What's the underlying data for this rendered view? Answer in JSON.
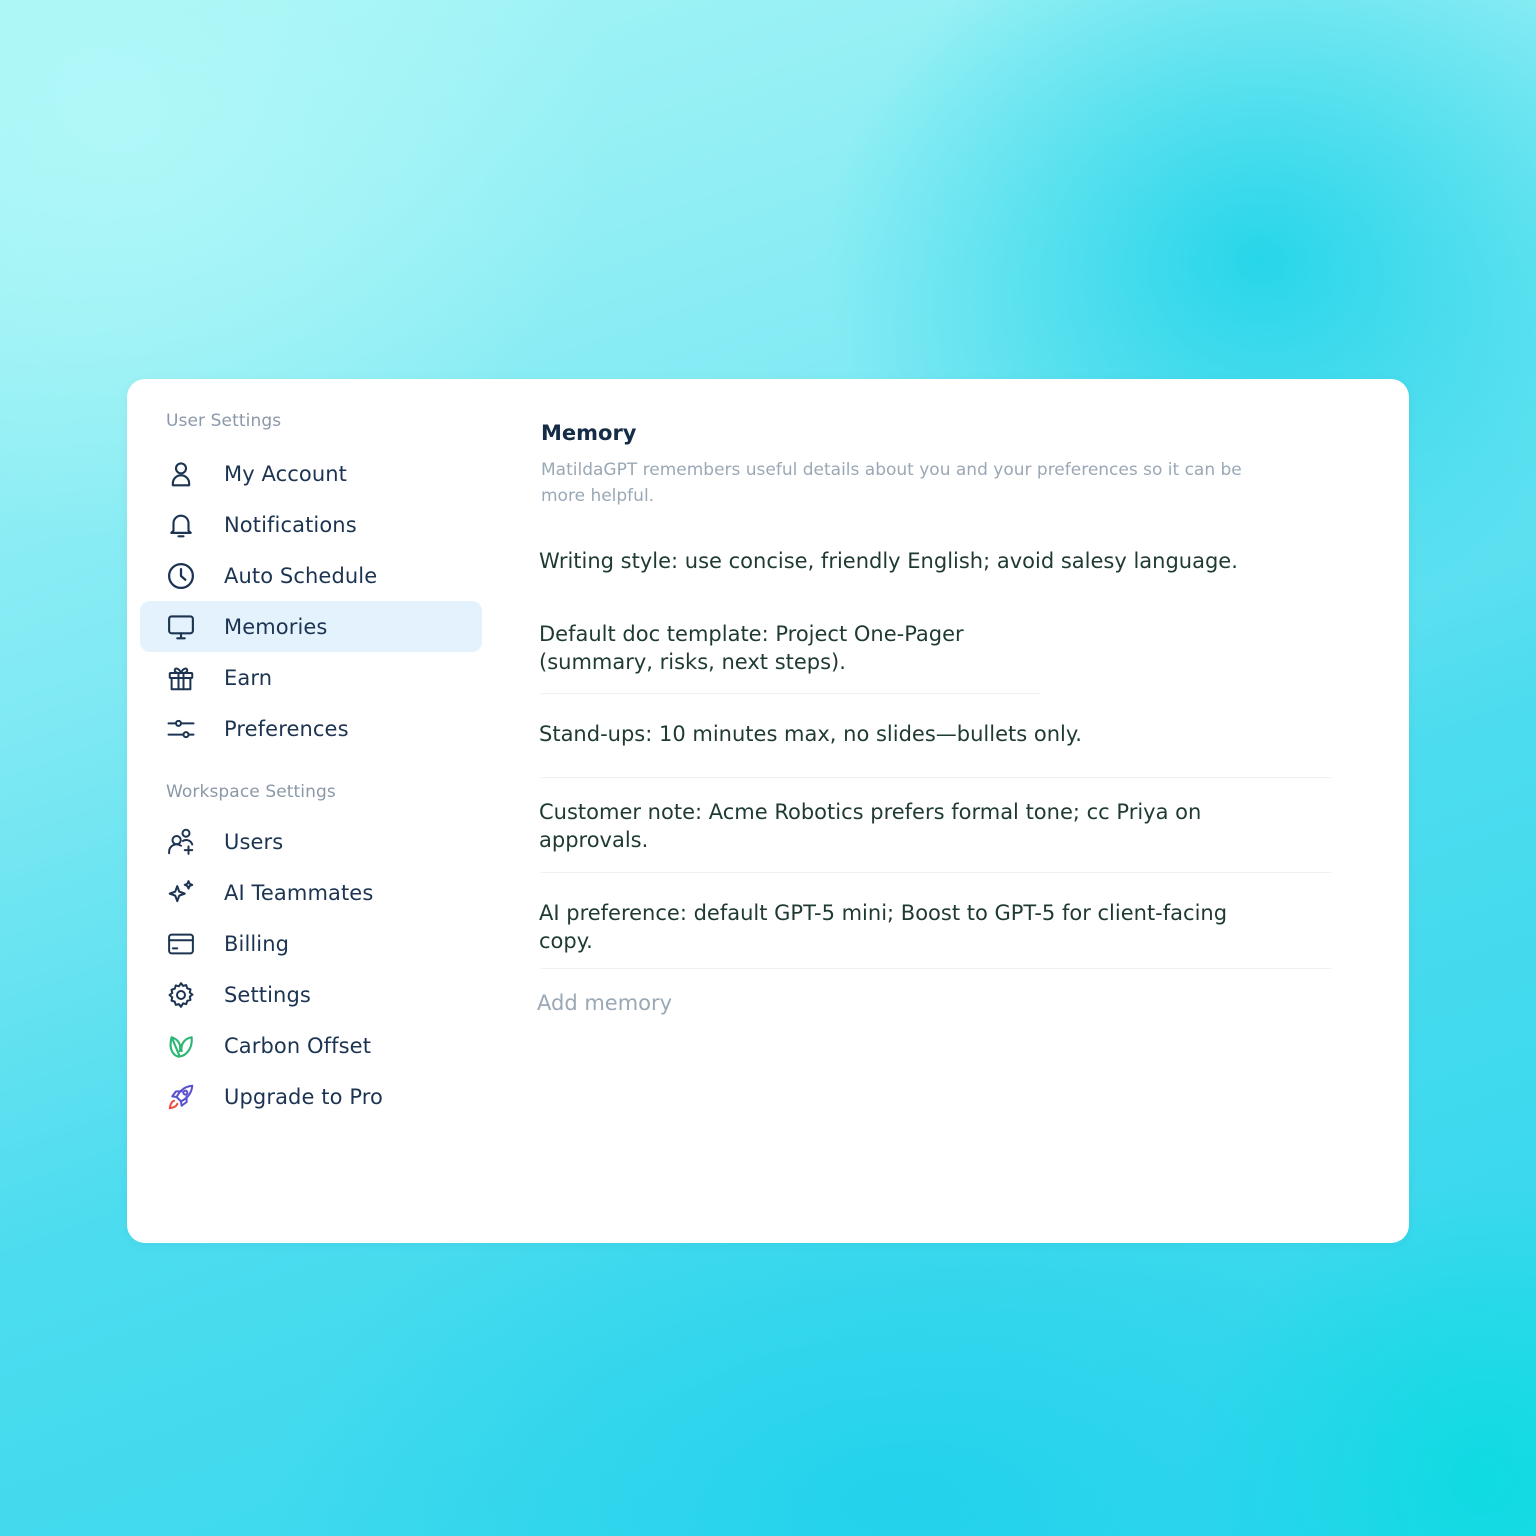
{
  "sidebar": {
    "user_section_label": "User Settings",
    "workspace_section_label": "Workspace Settings",
    "user_items": [
      {
        "label": "My Account",
        "icon": "user-icon"
      },
      {
        "label": "Notifications",
        "icon": "bell-icon"
      },
      {
        "label": "Auto Schedule",
        "icon": "clock-icon"
      },
      {
        "label": "Memories",
        "icon": "monitor-icon",
        "active": true
      },
      {
        "label": "Earn",
        "icon": "gift-icon"
      },
      {
        "label": "Preferences",
        "icon": "sliders-icon"
      }
    ],
    "workspace_items": [
      {
        "label": "Users",
        "icon": "add-users-icon"
      },
      {
        "label": "AI Teammates",
        "icon": "sparkles-icon"
      },
      {
        "label": "Billing",
        "icon": "credit-card-icon"
      },
      {
        "label": "Settings",
        "icon": "gear-icon"
      },
      {
        "label": "Carbon Offset",
        "icon": "leaf-icon"
      },
      {
        "label": "Upgrade to Pro",
        "icon": "rocket-icon"
      }
    ]
  },
  "main": {
    "title": "Memory",
    "description": "MatildaGPT remembers useful details about you and your preferences so it can be more helpful.",
    "memories": [
      "Writing style: use concise, friendly English; avoid salesy language.",
      "Default doc template: Project One-Pager (summary, risks, next steps).",
      "Stand-ups: 10 minutes max, no slides—bullets only.",
      "Customer note: Acme Robotics prefers formal tone; cc Priya on approvals.",
      "AI preference: default GPT-5 mini; Boost to GPT-5 for client-facing copy."
    ],
    "add_placeholder": "Add memory"
  },
  "colors": {
    "text_primary": "#1c3452",
    "text_muted": "#8b98a8",
    "active_bg": "#e3f2fc",
    "leaf_green": "#2bb673",
    "rocket_purple": "#5a4fcf",
    "rocket_flame": "#f0493e"
  }
}
